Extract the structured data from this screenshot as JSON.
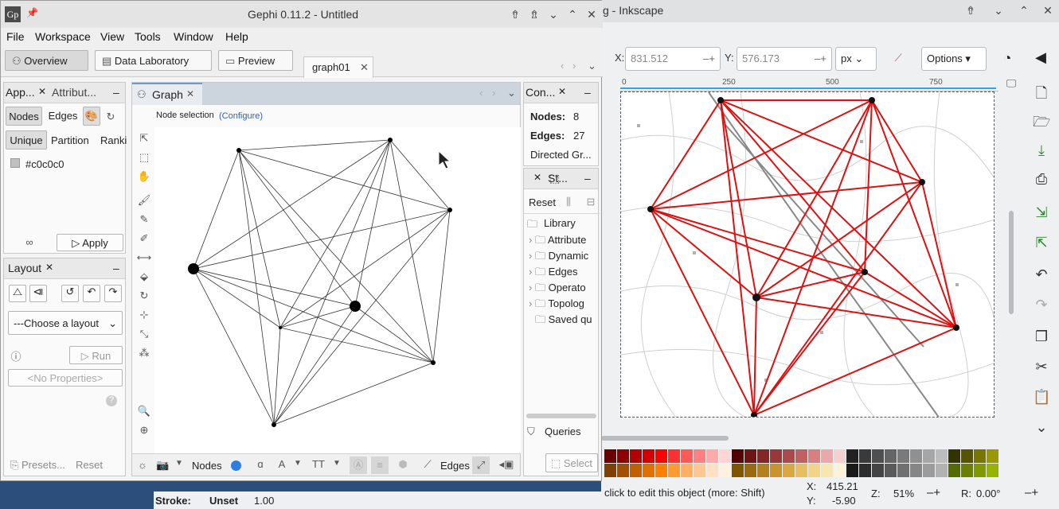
{
  "inkscape": {
    "title": "g - Inkscape",
    "x_label": "X:",
    "x_value": "831.512",
    "y_label": "Y:",
    "y_value": "576.173",
    "unit": "px",
    "options_label": "Options",
    "ruler_ticks": [
      "0",
      "250",
      "500",
      "750"
    ],
    "status_text": "click to edit this object (more: Shift)",
    "coords_x_label": "X:",
    "coords_x": "415.21",
    "coords_y_label": "Y:",
    "coords_y": "-5.90",
    "zoom_label": "Z:",
    "zoom": "51%",
    "rotation_label": "R:",
    "rotation": "0.00°",
    "stroke_label": "Stroke:",
    "stroke_value": "Unset",
    "stroke_width": "1.00",
    "palette": [
      "#6b0000",
      "#8f0000",
      "#b30000",
      "#d40000",
      "#ff0000",
      "#ff3030",
      "#ff5a5a",
      "#ff8080",
      "#ffaaaa",
      "#ffd5d5",
      "#550000",
      "#6e1414",
      "#842626",
      "#993838",
      "#aa4a4a",
      "#c06060",
      "#d88080",
      "#eaa8a8",
      "#f5d0d0",
      "#222222",
      "#3a3a3a",
      "#4f4f4f",
      "#656565",
      "#7a7a7a",
      "#909090",
      "#a6a6a6",
      "#bcbcbc",
      "#333300",
      "#555500",
      "#777700",
      "#999900"
    ],
    "palette2": [
      "#804000",
      "#a05000",
      "#c06000",
      "#e07000",
      "#ff8000",
      "#ff9a30",
      "#ffb060",
      "#ffc890",
      "#ffe0c0",
      "#fff0e0",
      "#805500",
      "#996a10",
      "#b38020",
      "#c89430",
      "#d9a840",
      "#e8bf60",
      "#f2d488",
      "#f8e6b0",
      "#fcf3d8",
      "#1a1a1a",
      "#2d2d2d",
      "#444444",
      "#5a5a5a",
      "#707070",
      "#868686",
      "#9c9c9c",
      "#b2b2b2",
      "#556b00",
      "#6b8000",
      "#809900",
      "#96b300"
    ]
  },
  "gephi": {
    "title": "Gephi 0.11.2 - Untitled",
    "menu": [
      "File",
      "Workspace",
      "View",
      "Tools",
      "Window",
      "Help"
    ],
    "overview_label": "Overview",
    "data_lab_label": "Data Laboratory",
    "preview_label": "Preview",
    "workspace_tab": "graph01",
    "appearance": {
      "tab1": "App...",
      "tab2": "Attribut...",
      "nodes_label": "Nodes",
      "edges_label": "Edges",
      "unique_label": "Unique",
      "partition_label": "Partition",
      "ranking_label": "Ranki",
      "color_label": "#c0c0c0",
      "apply_label": "Apply"
    },
    "layout": {
      "tab": "Layout",
      "choose_label": "---Choose a layout",
      "run_label": "Run",
      "no_props": "<No Properties>",
      "presets_label": "Presets...",
      "reset_label": "Reset"
    },
    "graph": {
      "tab": "Graph",
      "node_selection": "Node selection",
      "configure": "(Configure)",
      "bottom_nodes": "Nodes",
      "bottom_edges": "Edges"
    },
    "context": {
      "tab": "Con...",
      "nodes_label": "Nodes:",
      "nodes_value": "8",
      "edges_label": "Edges:",
      "edges_value": "27",
      "type_label": "Directed Gr..."
    },
    "stats": {
      "tab": "St...",
      "reset_label": "Reset",
      "library_label": "Library",
      "folders": [
        "Attribute",
        "Dynamic",
        "Edges",
        "Operato",
        "Topolog",
        "Saved qu"
      ],
      "queries_label": "Queries",
      "select_label": "Select"
    }
  }
}
